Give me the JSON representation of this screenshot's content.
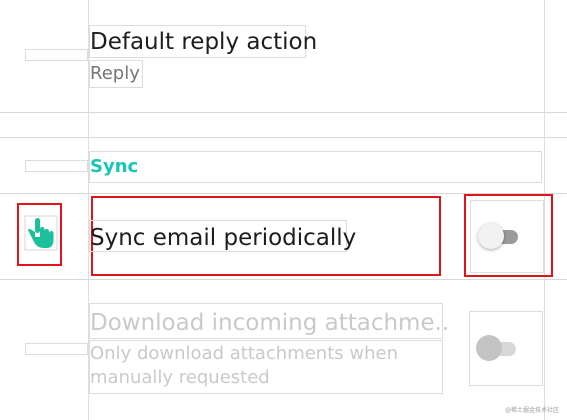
{
  "settings": {
    "default_reply": {
      "title": "Default reply action",
      "summary": "Reply"
    },
    "sync_section": {
      "header": "Sync"
    },
    "sync_email": {
      "title": "Sync email periodically",
      "enabled": false
    },
    "download_attachments": {
      "title": "Download incoming attachme..",
      "summary": "Only download attachments when manually requested",
      "enabled": false,
      "disabled_state": true
    }
  },
  "icons": {
    "touch": "hand-pointer-icon"
  },
  "colors": {
    "accent": "#16c6b6",
    "highlight": "#e0141c",
    "icon": "#1bbf9a"
  },
  "watermark": "@稀土掘金技术社区"
}
